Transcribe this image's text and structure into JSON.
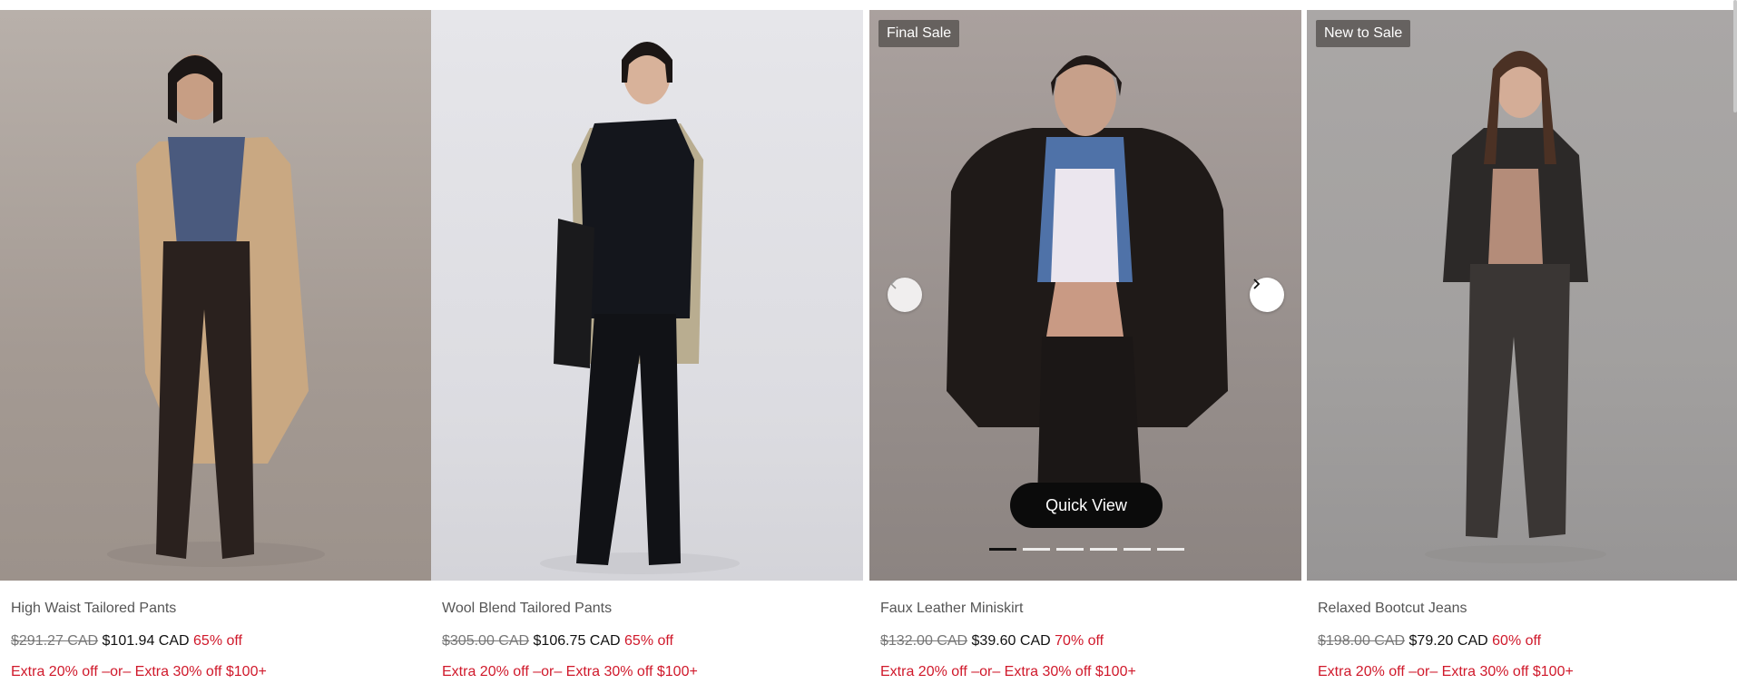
{
  "products": [
    {
      "name": "High Waist Tailored Pants",
      "original_price": "$291.27 CAD",
      "sale_price": "$101.94 CAD",
      "discount": "65% off",
      "promo": "Extra 20% off –or– Extra 30% off $100+"
    },
    {
      "name": "Wool Blend Tailored Pants",
      "original_price": "$305.00 CAD",
      "sale_price": "$106.75 CAD",
      "discount": "65% off",
      "promo": "Extra 20% off –or– Extra 30% off $100+"
    },
    {
      "name": "Faux Leather Miniskirt",
      "badge": "Final Sale",
      "original_price": "$132.00 CAD",
      "sale_price": "$39.60 CAD",
      "discount": "70% off",
      "promo": "Extra 20% off –or– Extra 30% off $100+",
      "quick_view_label": "Quick View",
      "carousel": {
        "slide_count": 6,
        "active_index": 0
      }
    },
    {
      "name": "Relaxed Bootcut Jeans",
      "badge": "New to Sale",
      "original_price": "$198.00 CAD",
      "sale_price": "$79.20 CAD",
      "discount": "60% off",
      "promo": "Extra 20% off –or– Extra 30% off $100+"
    }
  ],
  "icons": {
    "prev": "chevron-left-icon",
    "next": "chevron-right-icon"
  },
  "colors": {
    "discount": "#d0192b",
    "badge_bg": "#5a5654",
    "quick_view_bg": "#0b0b0b"
  }
}
